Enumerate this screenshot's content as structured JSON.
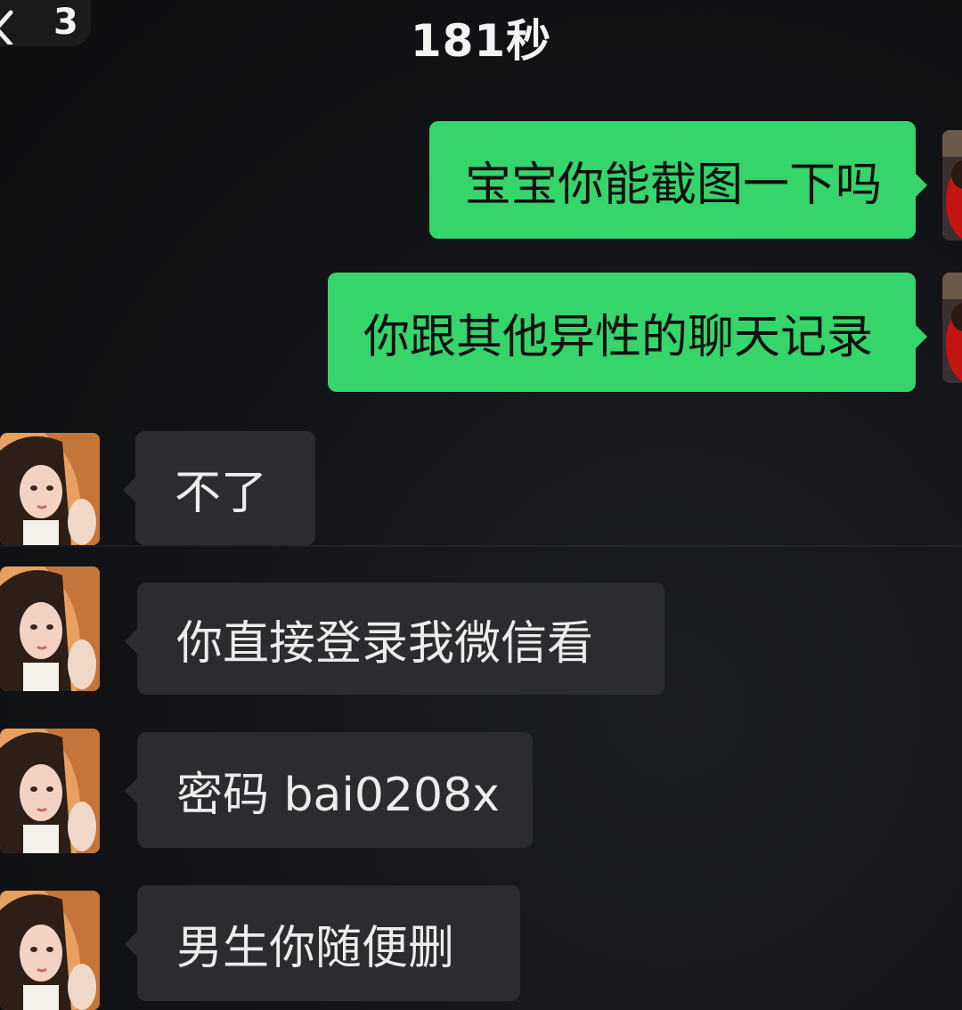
{
  "header": {
    "unread_count": "3",
    "title": "181秒"
  },
  "messages": [
    {
      "side": "sent",
      "text": "宝宝你能截图一下吗"
    },
    {
      "side": "sent",
      "text": "你跟其他异性的聊天记录"
    },
    {
      "side": "received",
      "text": "不了"
    },
    {
      "side": "received",
      "text": "你直接登录我微信看"
    },
    {
      "side": "received",
      "text": "密码 bai0208x"
    },
    {
      "side": "received",
      "text": "男生你随便删"
    }
  ]
}
